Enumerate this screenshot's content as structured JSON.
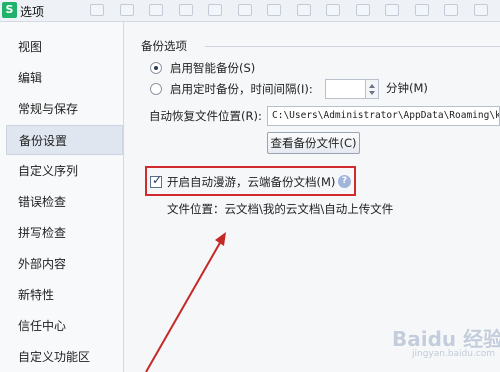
{
  "window": {
    "title": "选项",
    "logo_letter": "S"
  },
  "sidebar": {
    "items": [
      {
        "label": "视图"
      },
      {
        "label": "编辑"
      },
      {
        "label": "常规与保存"
      },
      {
        "label": "备份设置",
        "selected": true
      },
      {
        "label": "自定义序列"
      },
      {
        "label": "错误检查"
      },
      {
        "label": "拼写检查"
      },
      {
        "label": "外部内容"
      },
      {
        "label": "新特性"
      },
      {
        "label": "信任中心"
      },
      {
        "label": "自定义功能区"
      }
    ]
  },
  "backup": {
    "section_title": "备份选项",
    "smart_backup_label": "启用智能备份(S)",
    "smart_backup_checked": true,
    "timed_backup_label": "启用定时备份，时间间隔(I):",
    "timed_backup_checked": false,
    "interval_value": "",
    "minute_label": "分钟(M)",
    "recovery_location_label": "自动恢复文件位置(R):",
    "recovery_location_value": "C:\\Users\\Administrator\\AppData\\Roaming\\ki",
    "view_backup_button": "查看备份文件(C)",
    "cloud_roam_label": "开启自动漫游，云端备份文档(M)",
    "cloud_roam_checked": true,
    "file_location_text": "文件位置：云文档\\我的云文档\\自动上传文件",
    "help_glyph": "?"
  },
  "annotation": {
    "highlight_color": "#d22b2b",
    "arrow_color": "#c62828"
  },
  "watermark": {
    "main": "Baidu 经验",
    "sub": "jingyan.baidu.com"
  }
}
